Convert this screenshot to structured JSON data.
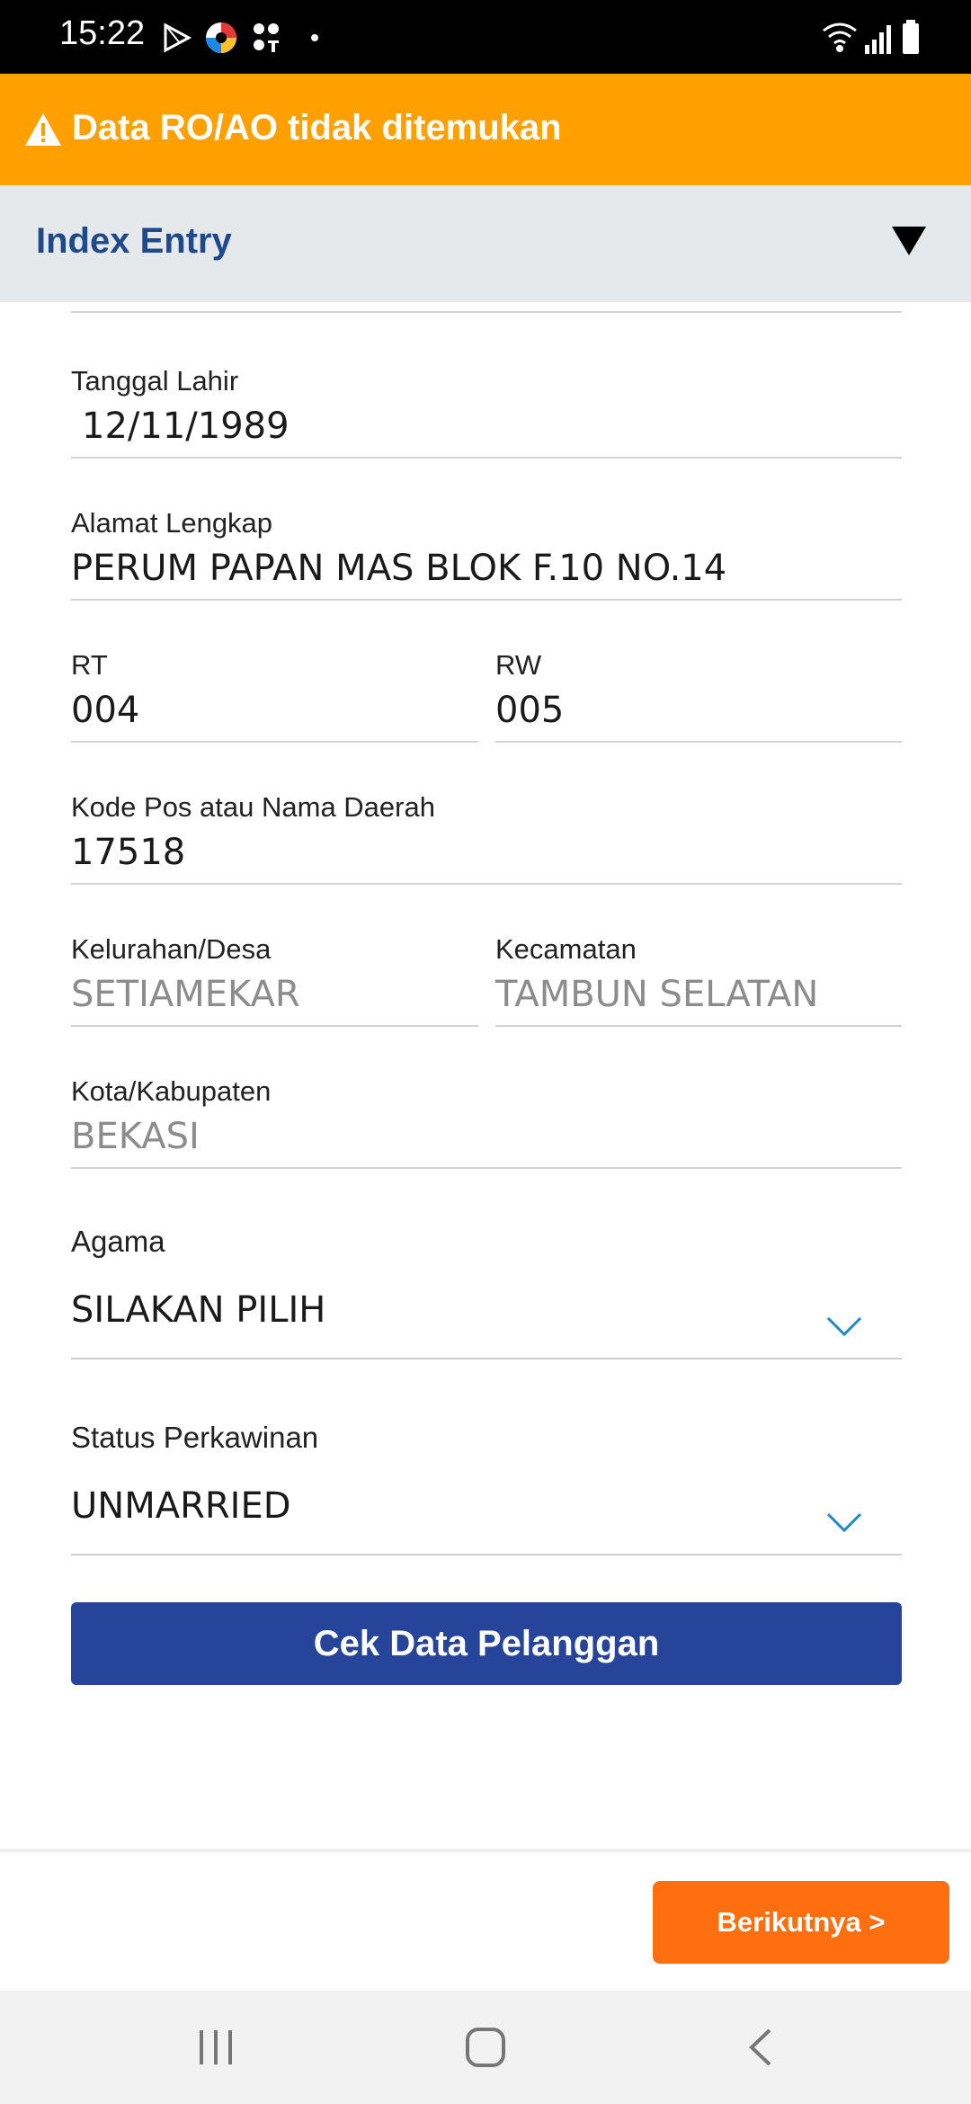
{
  "status_bar": {
    "time": "15:22",
    "icons_left": [
      "play-store-icon",
      "app-color-icon",
      "app-grid-icon",
      "dot-icon"
    ],
    "icons_right": [
      "wifi-icon",
      "signal-icon",
      "battery-icon"
    ]
  },
  "banner": {
    "text": "Data RO/AO tidak ditemukan",
    "icon": "warning-icon",
    "color": "#FFA000"
  },
  "section": {
    "title": "Index Entry",
    "toggle_icon": "triangle-down-icon"
  },
  "form": {
    "tanggal_lahir": {
      "label": "Tanggal Lahir",
      "value": "12/11/1989"
    },
    "alamat": {
      "label": "Alamat Lengkap",
      "value": "PERUM PAPAN MAS BLOK F.10 NO.14"
    },
    "rt": {
      "label": "RT",
      "value": "004"
    },
    "rw": {
      "label": "RW",
      "value": "005"
    },
    "kode_pos": {
      "label": "Kode Pos atau Nama Daerah",
      "value": "17518"
    },
    "kelurahan": {
      "label": "Kelurahan/Desa",
      "value": "SETIAMEKAR"
    },
    "kecamatan": {
      "label": "Kecamatan",
      "value": "TAMBUN SELATAN"
    },
    "kota": {
      "label": "Kota/Kabupaten",
      "value": "BEKASI"
    },
    "agama": {
      "label": "Agama",
      "value": "SILAKAN PILIH"
    },
    "status_perkawinan": {
      "label": "Status Perkawinan",
      "value": "UNMARRIED"
    }
  },
  "buttons": {
    "cek_data": "Cek Data Pelanggan",
    "next": "Berikutnya >"
  },
  "colors": {
    "banner": "#FFA000",
    "title": "#1E4A8C",
    "primary_button": "#26449A",
    "next_button": "#FF6F0F"
  }
}
